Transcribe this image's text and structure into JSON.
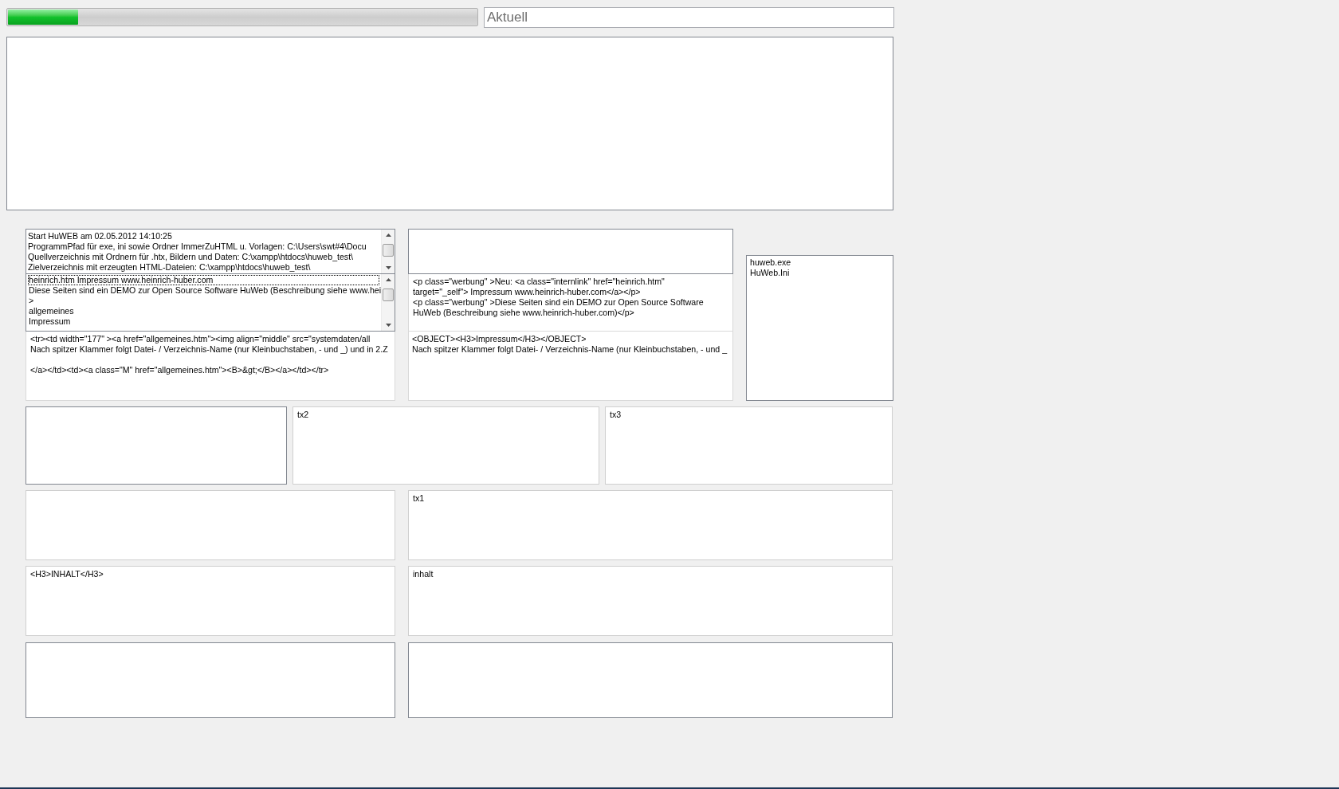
{
  "progress": {
    "level": 0.15
  },
  "current_field": {
    "placeholder": "Aktuell"
  },
  "log_list": {
    "lines": [
      "Start HuWEB am 02.05.2012 14:10:25",
      "ProgrammPfad für exe, ini sowie Ordner ImmerZuHTML u. Vorlagen: C:\\Users\\swt#4\\Docu",
      "Quellverzeichnis mit Ordnern für .htx, Bildern und Daten: C:\\xampp\\htdocs\\huweb_test\\",
      "Zielverzeichnis mit erzeugten HTML-Dateien: C:\\xampp\\htdocs\\huweb_test\\"
    ]
  },
  "page_list": {
    "items": [
      {
        "text": "heinrich.htm Impressum www.heinrich-huber.com",
        "selected": false,
        "focused": true
      },
      {
        "text": "Diese Seiten sind ein DEMO zur Open Source Software HuWeb (Beschreibung siehe www.hei",
        "selected": false,
        "focused": false
      },
      {
        "text": ">",
        "selected": false,
        "focused": false
      },
      {
        "text": "allgemeines",
        "selected": false,
        "focused": false
      },
      {
        "text": "Impressum",
        "selected": false,
        "focused": false
      }
    ]
  },
  "template_box": {
    "text": "<tr><td width=\"177\" ><a href=\"allgemeines.htm\"><img align=\"middle\" src=\"systemdaten/all\nNach spitzer Klammer folgt Datei- / Verzeichnis-Name (nur Kleinbuchstaben, - und _) und in 2.Z\n\n</a></td><td><a class=\"M\" href=\"allgemeines.htm\"><B>&gt;</B></a></td></tr>"
  },
  "html_box": {
    "text": "<p class=\"werbung\" >Neu: <a class=\"internlink\" href=\"heinrich.htm\"\ntarget=\"_self\"> Impressum www.heinrich-huber.com</a></p>\n<p class=\"werbung\" >Diese Seiten sind ein DEMO zur Open Source Software\nHuWeb (Beschreibung siehe www.heinrich-huber.com)</p>"
  },
  "object_box": {
    "text": "<OBJECT><H3>Impressum</H3></OBJECT>\nNach spitzer Klammer folgt Datei- / Verzeichnis-Name (nur Kleinbuchstaben, - und _"
  },
  "file_list": {
    "items": [
      {
        "text": "huweb.exe",
        "selected": false
      },
      {
        "text": "HuWeb.Ini",
        "selected": false
      }
    ]
  },
  "box_rows": [
    [
      {
        "kind": "panel"
      },
      {
        "kind": "memo",
        "text": "tx2"
      },
      {
        "kind": "memo",
        "text": "tx3"
      }
    ],
    [
      {
        "kind": "memo"
      },
      {
        "kind": "memo",
        "text": "tx1"
      }
    ],
    [
      {
        "kind": "memo",
        "text": "<H3>INHALT</H3>"
      },
      {
        "kind": "memo",
        "text": "inhalt"
      }
    ],
    [
      {
        "kind": "panel"
      },
      {
        "kind": "panel"
      }
    ]
  ]
}
